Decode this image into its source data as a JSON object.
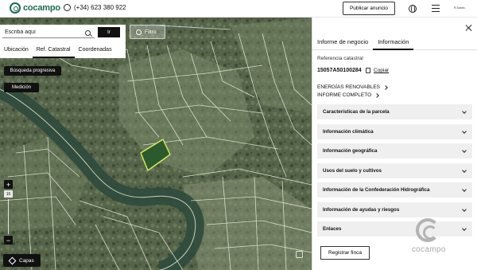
{
  "header": {
    "logo_text": "cocampo",
    "phone": "(+34) 623 380 922",
    "publish_label": "Publicar anuncio",
    "user_text": "R.Sanch.."
  },
  "search": {
    "placeholder": "Escriba aquí",
    "value": "Escriba aquí",
    "go_label": "Ir",
    "tabs": [
      "Ubicación",
      "Ref. Catastral",
      "Coordenadas"
    ],
    "active_tab": "Ref. Catastral"
  },
  "map": {
    "filter_label": "Filtro",
    "progressive_label": "Búsqueda progresiva",
    "measure_label": "Medición",
    "zoom_in": "+",
    "zoom_out": "−",
    "zoom_level": "16",
    "layers_label": "Capas",
    "colors": {
      "parcel_lines": "#e8f0dd",
      "selected_parcel": "#2c5a2e",
      "selected_outline": "#d8ef5c"
    }
  },
  "panel": {
    "tabs": [
      "Informe de negocio",
      "Información"
    ],
    "active_tab": "Información",
    "cadastral_label": "Referencia catastral",
    "cadastral_value": "15057A50100284",
    "copy_label": "Copiar",
    "links": [
      "ENERGÍAS RENOVABLES",
      "INFORME COMPLETO"
    ],
    "sections": [
      "Características de la parcela",
      "Información climática",
      "Información geográfica",
      "Usos del suelo y cultivos",
      "Información de la Confederación Hidrográfica",
      "Información de ayudas y riesgos",
      "Enlaces"
    ],
    "register_label": "Registrar finca",
    "watermark_text": "cocampo"
  }
}
